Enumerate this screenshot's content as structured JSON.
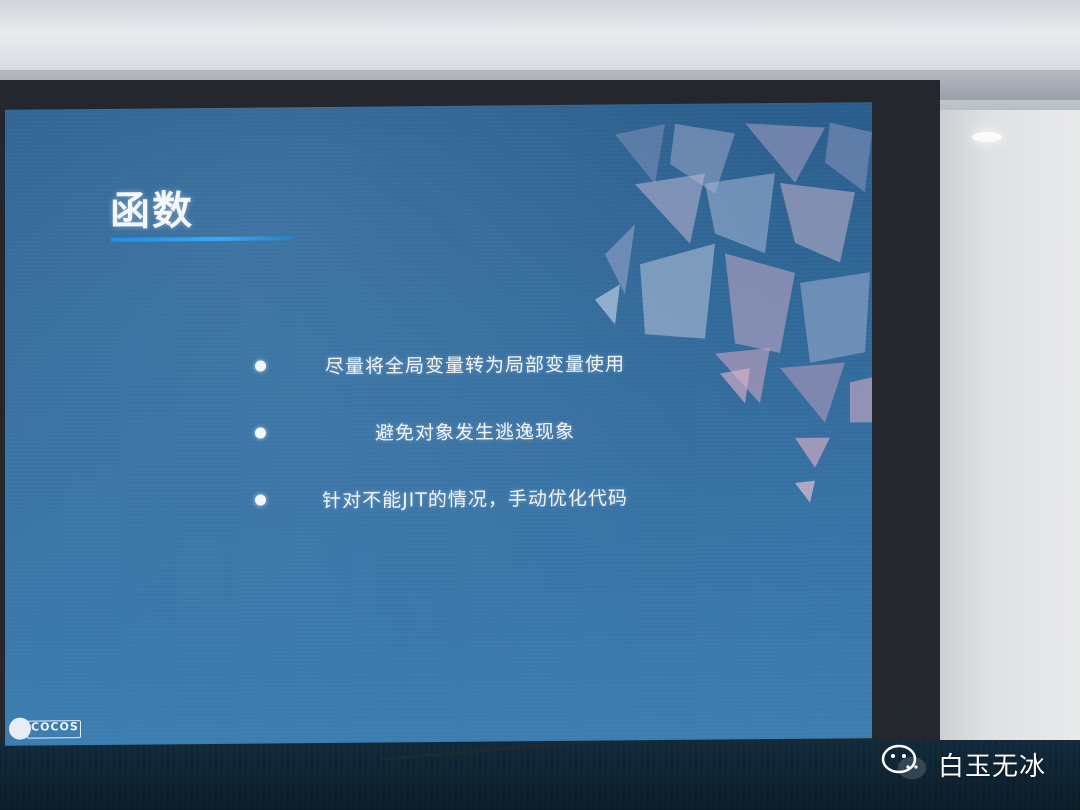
{
  "slide": {
    "title": "函数",
    "bullets": [
      "尽量将全局变量转为局部变量使用",
      "避免对象发生逃逸现象",
      "针对不能JIT的情况，手动优化代码"
    ],
    "logo_text": "COCOS"
  },
  "watermark": {
    "text": "白玉无冰",
    "icon": "wechat-icon"
  },
  "colors": {
    "slide_background": "#2f6797",
    "title_underline": "#1f8fe0",
    "text": "#f1f4f8"
  }
}
